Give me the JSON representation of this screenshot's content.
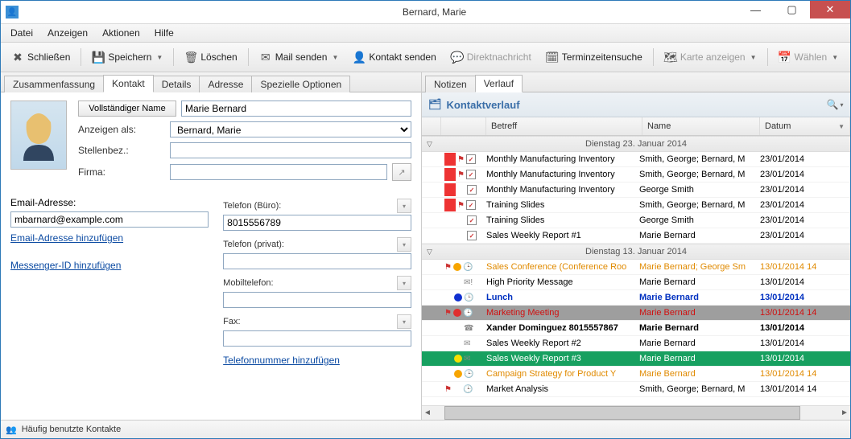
{
  "window": {
    "title": "Bernard, Marie"
  },
  "menu": {
    "file": "Datei",
    "view": "Anzeigen",
    "actions": "Aktionen",
    "help": "Hilfe"
  },
  "toolbar": {
    "close": "Schließen",
    "save": "Speichern",
    "delete": "Löschen",
    "mail": "Mail senden",
    "contact": "Kontakt senden",
    "dm": "Direktnachricht",
    "appt": "Terminzeitensuche",
    "map": "Karte anzeigen",
    "dial": "Wählen"
  },
  "left_tabs": {
    "summary": "Zusammenfassung",
    "contact": "Kontakt",
    "details": "Details",
    "address": "Adresse",
    "special": "Spezielle Optionen"
  },
  "right_tabs": {
    "notes": "Notizen",
    "history": "Verlauf"
  },
  "form": {
    "fullname_btn": "Vollständiger Name",
    "fullname_val": "Marie Bernard",
    "displayas_lbl": "Anzeigen als:",
    "displayas_val": "Bernard, Marie",
    "jobtitle_lbl": "Stellenbez.:",
    "jobtitle_val": "",
    "company_lbl": "Firma:",
    "company_val": "",
    "email_lbl": "Email-Adresse:",
    "email_val": "mbarnard@example.com",
    "add_email_link": "Email-Adresse hinzufügen",
    "add_im_link": "Messenger-ID hinzufügen",
    "phone_office_lbl": "Telefon (Büro):",
    "phone_office_val": "8015556789",
    "phone_home_lbl": "Telefon (privat):",
    "phone_home_val": "",
    "mobile_lbl": "Mobiltelefon:",
    "mobile_val": "",
    "fax_lbl": "Fax:",
    "fax_val": "",
    "add_phone_link": "Telefonnummer hinzufügen"
  },
  "history": {
    "panel_title": "Kontaktverlauf",
    "cols": {
      "subject": "Betreff",
      "name": "Name",
      "date": "Datum"
    },
    "group1": "Dienstag 23. Januar 2014",
    "group2": "Dienstag 13. Januar 2014",
    "rows1": [
      {
        "subject": "Monthly Manufacturing Inventory",
        "name": "Smith, George;  Bernard, M",
        "date": "23/01/2014",
        "red": true,
        "chk": true,
        "flag": true
      },
      {
        "subject": "Monthly Manufacturing Inventory",
        "name": "Smith, George;  Bernard, M",
        "date": "23/01/2014",
        "red": true,
        "chk": true,
        "flag": true
      },
      {
        "subject": "Monthly Manufacturing Inventory",
        "name": "George Smith",
        "date": "23/01/2014",
        "red": true,
        "chk": true,
        "flag": false
      },
      {
        "subject": "Training Slides",
        "name": "Smith, George;  Bernard, M",
        "date": "23/01/2014",
        "red": true,
        "chk": true,
        "flag": true
      },
      {
        "subject": "Training Slides",
        "name": "George Smith",
        "date": "23/01/2014",
        "red": false,
        "chk": true,
        "flag": false
      },
      {
        "subject": "Sales Weekly Report #1",
        "name": "Marie Bernard",
        "date": "23/01/2014",
        "red": false,
        "chk": true,
        "flag": false
      }
    ],
    "rows2": [
      {
        "subject": "Sales Conference (Conference Roo",
        "name": "Marie Bernard;  George Sm",
        "date": "13/01/2014 14",
        "style": "orange",
        "flag": true,
        "dot": "#f7a500",
        "icon": "clock"
      },
      {
        "subject": "High Priority Message",
        "name": "Marie Bernard",
        "date": "13/01/2014",
        "style": "",
        "icon": "mail-excl"
      },
      {
        "subject": "Lunch",
        "name": "Marie Bernard",
        "date": "13/01/2014",
        "style": "bold-blue",
        "dot": "#1030d0",
        "icon": "clock"
      },
      {
        "subject": "Marketing Meeting",
        "name": "Marie Bernard",
        "date": "13/01/2014 14",
        "style": "row-gray red-text",
        "flag": true,
        "dot": "#e03030",
        "icon": "clock"
      },
      {
        "subject": "Xander Dominguez 8015557867",
        "name": "Marie Bernard",
        "date": "13/01/2014",
        "style": "bold",
        "icon": "phone"
      },
      {
        "subject": "Sales Weekly Report #2",
        "name": "Marie Bernard",
        "date": "13/01/2014",
        "style": "",
        "icon": "mail"
      },
      {
        "subject": "Sales Weekly Report #3",
        "name": "Marie Bernard",
        "date": "13/01/2014",
        "style": "row-green",
        "dot": "#f5e000",
        "icon": "mail"
      },
      {
        "subject": "Campaign Strategy for Product Y",
        "name": "Marie Bernard",
        "date": "13/01/2014 14",
        "style": "orange",
        "dot": "#f7a500",
        "icon": "clock"
      },
      {
        "subject": "Market Analysis",
        "name": "Smith, George;  Bernard, M",
        "date": "13/01/2014 14",
        "style": "",
        "flag": true,
        "icon": "clock"
      }
    ]
  },
  "statusbar": {
    "freq": "Häufig benutzte Kontakte"
  }
}
